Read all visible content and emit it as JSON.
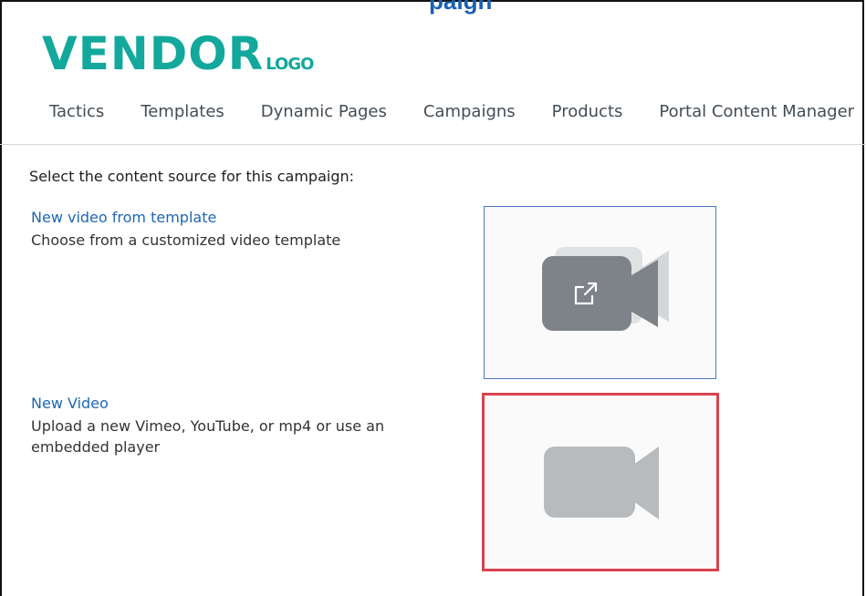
{
  "header": {
    "logo_main": "VENDOR",
    "logo_sub": "LOGO",
    "cut_title_fragment": "paign"
  },
  "nav": {
    "items": [
      {
        "label": "Tactics"
      },
      {
        "label": "Templates"
      },
      {
        "label": "Dynamic Pages"
      },
      {
        "label": "Campaigns"
      },
      {
        "label": "Products"
      },
      {
        "label": "Portal Content Manager"
      }
    ]
  },
  "main": {
    "prompt": "Select the content source for this campaign:",
    "options": [
      {
        "title": "New video from template",
        "description": "Choose from a customized video template",
        "icon": "video-template-icon"
      },
      {
        "title": "New Video",
        "description": "Upload a new Vimeo, YouTube, or mp4 or use an embedded player",
        "icon": "video-camera-icon"
      }
    ]
  },
  "colors": {
    "logo": "#12a89b",
    "link": "#1f66b3",
    "selected_border": "#d9434f",
    "card_border": "#4a79c2",
    "icon_dark": "#7d8388",
    "icon_light": "#b8bbbe"
  }
}
